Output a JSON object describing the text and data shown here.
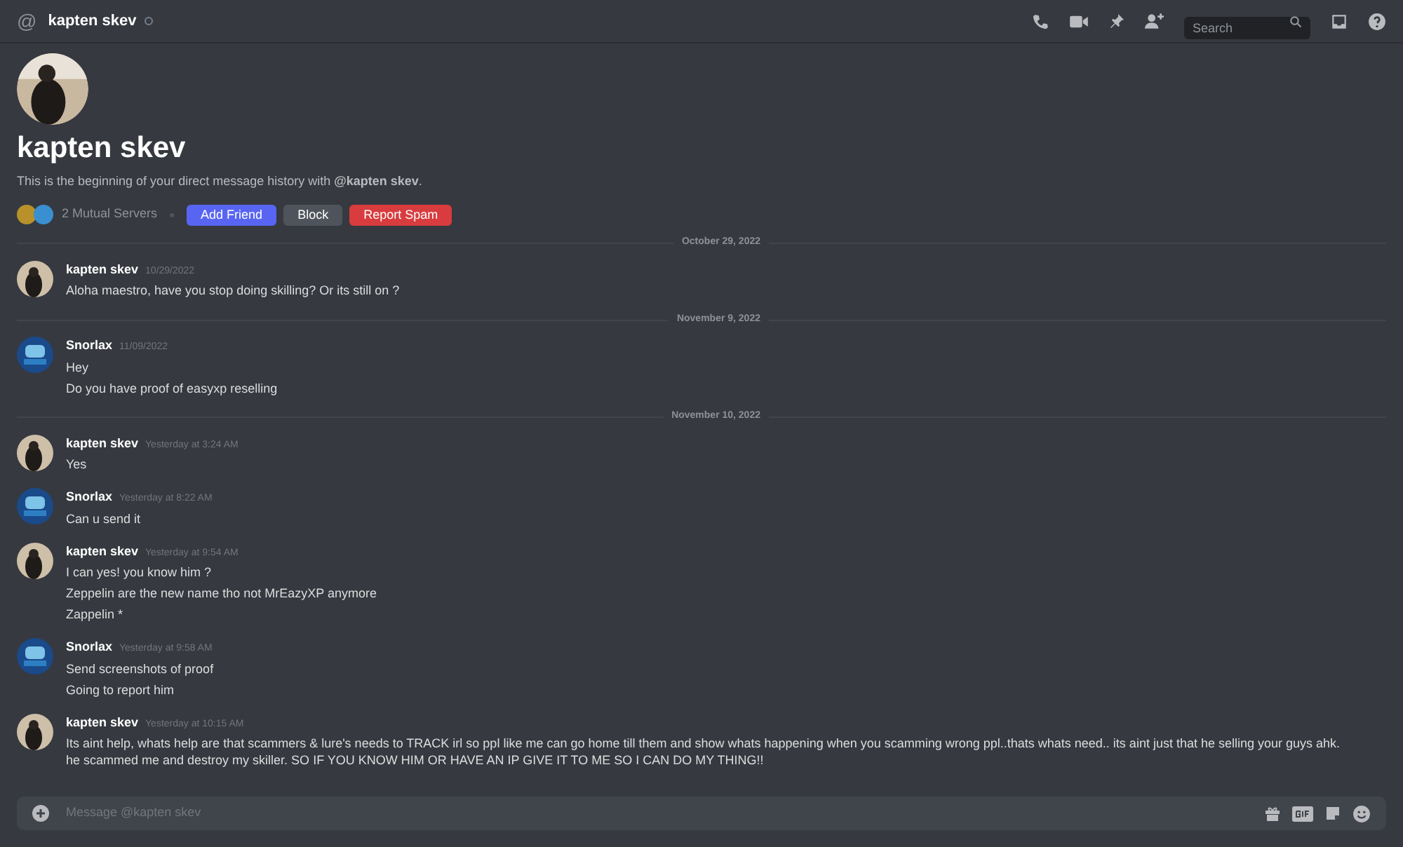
{
  "header": {
    "icon": "@",
    "title": "kapten skev",
    "search": {
      "placeholder": "Search"
    }
  },
  "profile": {
    "name": "kapten skev",
    "intro": "This is the beginning of your direct message history with **@kapten skev**.",
    "mutual": "2 Mutual Servers",
    "buttons": [
      {
        "label": "Add Friend",
        "kind": "primary"
      },
      {
        "label": "Block",
        "kind": "secondary"
      },
      {
        "label": "Report Spam",
        "kind": "danger"
      }
    ]
  },
  "feed": [
    {
      "kind": "divider",
      "label": "October 29, 2022"
    },
    {
      "kind": "message",
      "author": "kapten skev",
      "avatar": {
        "kind": "cat"
      },
      "time": "10/29/2022",
      "lines": [
        "Aloha maestro,  have you stop doing skilling? Or its still on ?"
      ]
    },
    {
      "kind": "divider",
      "label": "November 9, 2022"
    },
    {
      "kind": "message",
      "author": "Snorlax",
      "avatar": {
        "kind": "badge"
      },
      "time": "11/09/2022",
      "lines": [
        "Hey",
        "Do you have proof of easyxp reselling"
      ]
    },
    {
      "kind": "divider",
      "label": "November 10, 2022"
    },
    {
      "kind": "message",
      "author": "kapten skev",
      "avatar": {
        "kind": "cat"
      },
      "time": "Yesterday at 3:24 AM",
      "lines": [
        "Yes"
      ]
    },
    {
      "kind": "message",
      "author": "Snorlax",
      "avatar": {
        "kind": "badge"
      },
      "time": "Yesterday at 8:22 AM",
      "lines": [
        "Can u send it"
      ]
    },
    {
      "kind": "message",
      "author": "kapten skev",
      "avatar": {
        "kind": "cat"
      },
      "time": "Yesterday at 9:54 AM",
      "lines": [
        "I can yes! you know him ?",
        "Zeppelin are the new name tho not MrEazyXP anymore",
        "Zappelin *"
      ]
    },
    {
      "kind": "message",
      "author": "Snorlax",
      "avatar": {
        "kind": "badge"
      },
      "time": "Yesterday at 9:58 AM",
      "lines": [
        "Send screenshots of proof",
        "Going to report him"
      ]
    },
    {
      "kind": "message",
      "author": "kapten skev",
      "avatar": {
        "kind": "cat"
      },
      "time": "Yesterday at 10:15 AM",
      "lines": [
        "Its aint help,  whats help are that scammers & lure's needs to TRACK irl so ppl like me can go home till them and show whats happening when you scamming wrong ppl..thats whats need.. its aint just that he selling your guys ahk. he scammed me and destroy my skiller. SO IF YOU KNOW HIM OR HAVE AN IP GIVE IT TO ME SO I CAN DO MY THING!!"
      ]
    }
  ],
  "composer": {
    "placeholder": "Message @kapten skev"
  }
}
